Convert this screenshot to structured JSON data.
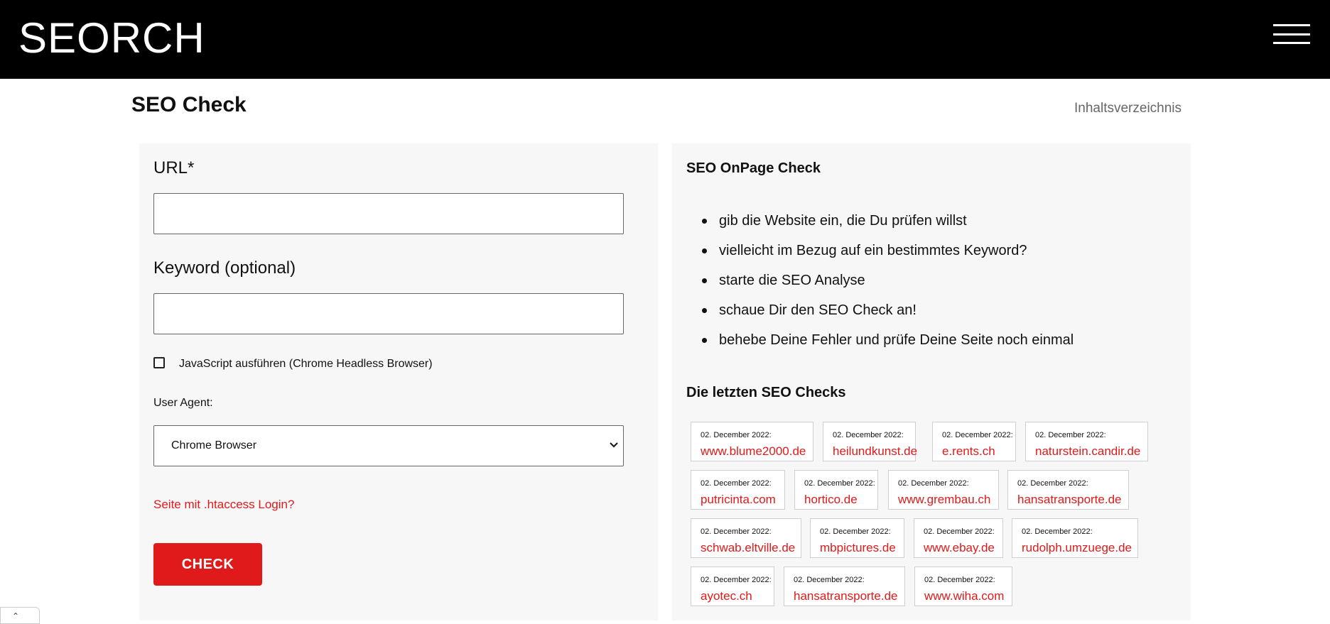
{
  "header": {
    "logo": "SEORCH",
    "menu_icon": "hamburger-menu-icon"
  },
  "page": {
    "title": "SEO Check",
    "toc_link": "Inhaltsverzeichnis"
  },
  "form": {
    "url_label": "URL*",
    "url_value": "",
    "keyword_label": "Keyword (optional)",
    "keyword_value": "",
    "js_checkbox_label": "JavaScript ausführen (Chrome Headless Browser)",
    "js_checked": false,
    "user_agent_label": "User Agent:",
    "user_agent_value": "Chrome Browser",
    "user_agent_icon": "chevron-down-icon",
    "htaccess_link": "Seite mit .htaccess Login?",
    "submit_label": "CHECK"
  },
  "info": {
    "title": "SEO OnPage Check",
    "steps": [
      "gib die Website ein, die Du prüfen willst",
      "vielleicht im Bezug auf ein bestimmtes Keyword?",
      "starte die SEO Analyse",
      "schaue Dir den SEO Check an!",
      "behebe Deine Fehler und prüfe Deine Seite noch einmal"
    ]
  },
  "recent": {
    "title": "Die letzten SEO Checks",
    "rows": [
      [
        {
          "date": "02. December 2022:",
          "domain": "www.blume2000.de"
        },
        {
          "date": "02. December 2022:",
          "domain": "heilundkunst.de"
        },
        {
          "date": "02. December 2022:",
          "domain": "e.rents.ch"
        },
        {
          "date": "02. December 2022:",
          "domain": "naturstein.candir.de"
        }
      ],
      [
        {
          "date": "02. December 2022:",
          "domain": "putricinta.com"
        },
        {
          "date": "02. December 2022:",
          "domain": "hortico.de"
        },
        {
          "date": "02. December 2022:",
          "domain": "www.grembau.ch"
        },
        {
          "date": "02. December 2022:",
          "domain": "hansatransporte.de"
        }
      ],
      [
        {
          "date": "02. December 2022:",
          "domain": "schwab.eltville.de"
        },
        {
          "date": "02. December 2022:",
          "domain": "mbpictures.de"
        },
        {
          "date": "02. December 2022:",
          "domain": "www.ebay.de"
        },
        {
          "date": "02. December 2022:",
          "domain": "rudolph.umzuege.de"
        }
      ],
      [
        {
          "date": "02. December 2022:",
          "domain": "ayotec.ch"
        },
        {
          "date": "02. December 2022:",
          "domain": "hansatransporte.de"
        },
        {
          "date": "02. December 2022:",
          "domain": "www.wiha.com"
        }
      ]
    ]
  },
  "colors": {
    "accent": "#e01a1a",
    "header_bg": "#000000",
    "panel_bg": "#f7f7f7"
  }
}
